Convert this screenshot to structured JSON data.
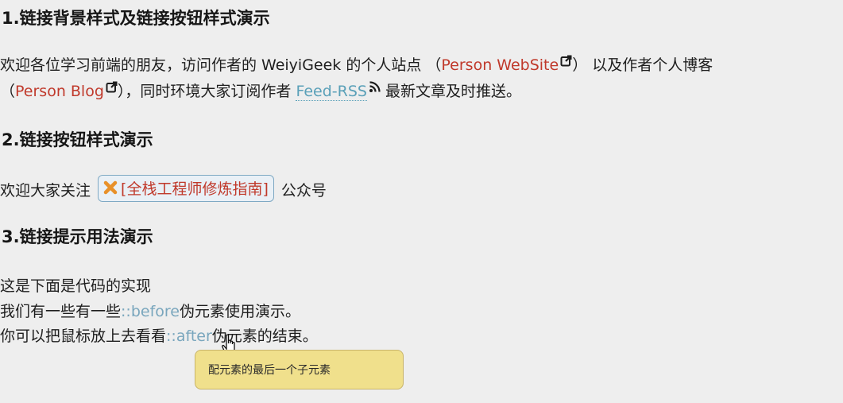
{
  "section1": {
    "heading": "1.链接背景样式及链接按钮样式演示",
    "line1_prefix": "欢迎各位学习前端的朋友，访问作者的 WeiyiGeek 的个人站点 （",
    "personal_site_link": "Person WebSite",
    "line1_suffix": "） 以及作者个人博客",
    "line2_prefix": "（",
    "blog_link": "Person Blog",
    "line2_mid": "），同时环境大家订阅作者 ",
    "feed_link": "Feed-RSS",
    "line2_suffix": " 最新文章及时推送。"
  },
  "section2": {
    "heading": "2.链接按钮样式演示",
    "prefix": "欢迎大家关注 ",
    "button_text": "[全栈工程师修炼指南]",
    "suffix": " 公众号"
  },
  "section3": {
    "heading": "3.链接提示用法演示",
    "line1": "这是下面是代码的实现",
    "line2_prefix": "我们有一些有一些",
    "before_link": "::before",
    "line2_suffix": "伪元素使用演示。",
    "line3_prefix": "你可以把鼠标放上去看看",
    "after_link": "::after",
    "line3_suffix": "伪元素的结束。",
    "tooltip": "配元素的最后一个子元素"
  },
  "icons": {
    "external": "external-link-icon",
    "rss": "rss-icon",
    "close": "close-x-icon",
    "cursor": "hand-cursor-icon"
  },
  "colors": {
    "link_red": "#c0392b",
    "link_blue": "#5aa0b8",
    "tooltip_bg": "#f0e08c",
    "x_orange": "#e8912a"
  }
}
